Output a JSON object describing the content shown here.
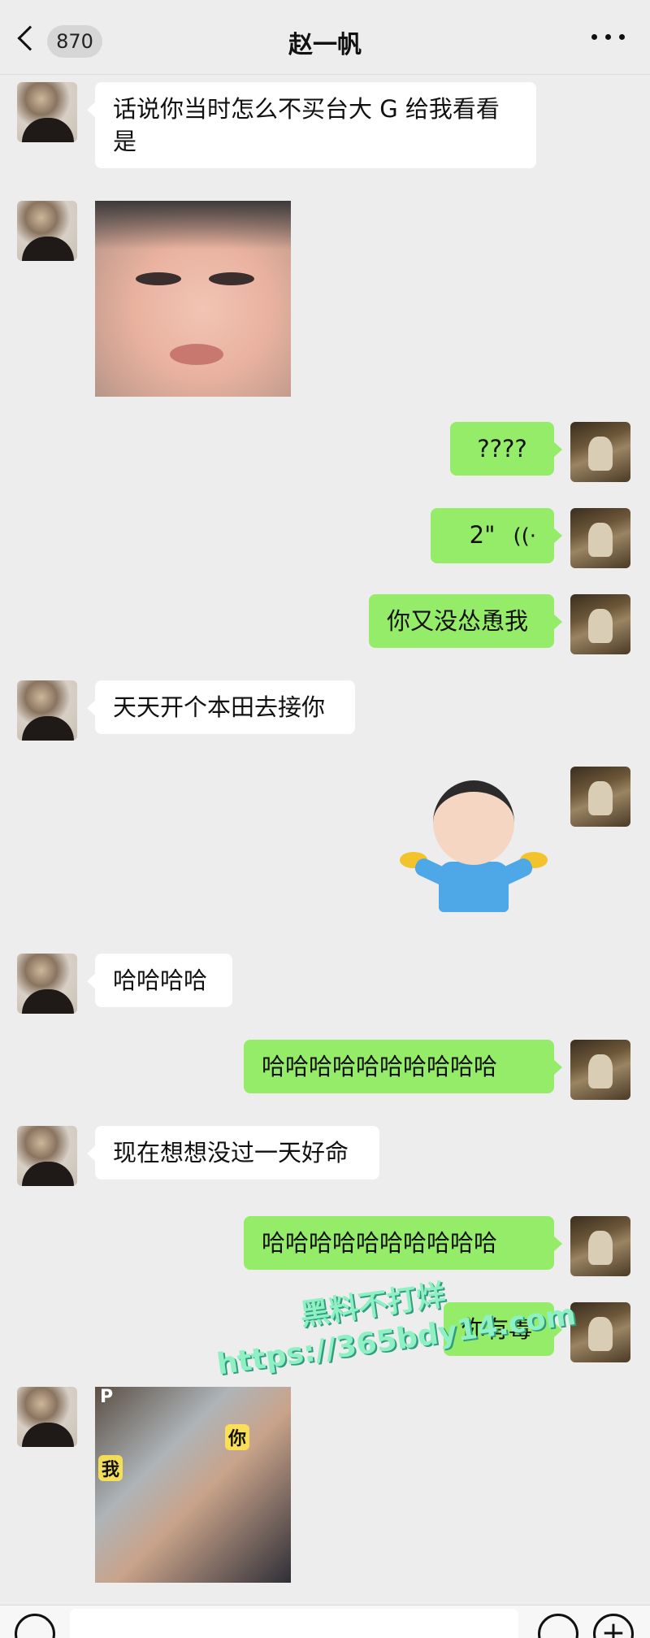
{
  "header": {
    "unread_count": "870",
    "title": "赵一帆"
  },
  "messages": {
    "m1": "话说你当时怎么不买台大 G 给我看看是",
    "m3": "????",
    "m4_duration": "2\"",
    "m5": "你又没怂恿我",
    "m6": "天天开个本田去接你",
    "m8": "哈哈哈哈",
    "m9": "哈哈哈哈哈哈哈哈哈哈",
    "m10": "现在想想没过一天好命",
    "m11": "哈哈哈哈哈哈哈哈哈哈",
    "m12": "你有毒"
  },
  "stickers": {
    "gif_letter": "P",
    "gif_left_label": "我",
    "gif_right_label": "你"
  },
  "watermark": {
    "line1": "黑料不打烊",
    "line2": "https://365bdy14.com"
  },
  "colors": {
    "background": "#ededed",
    "bubble_sent": "#95ec69",
    "bubble_received": "#ffffff"
  }
}
